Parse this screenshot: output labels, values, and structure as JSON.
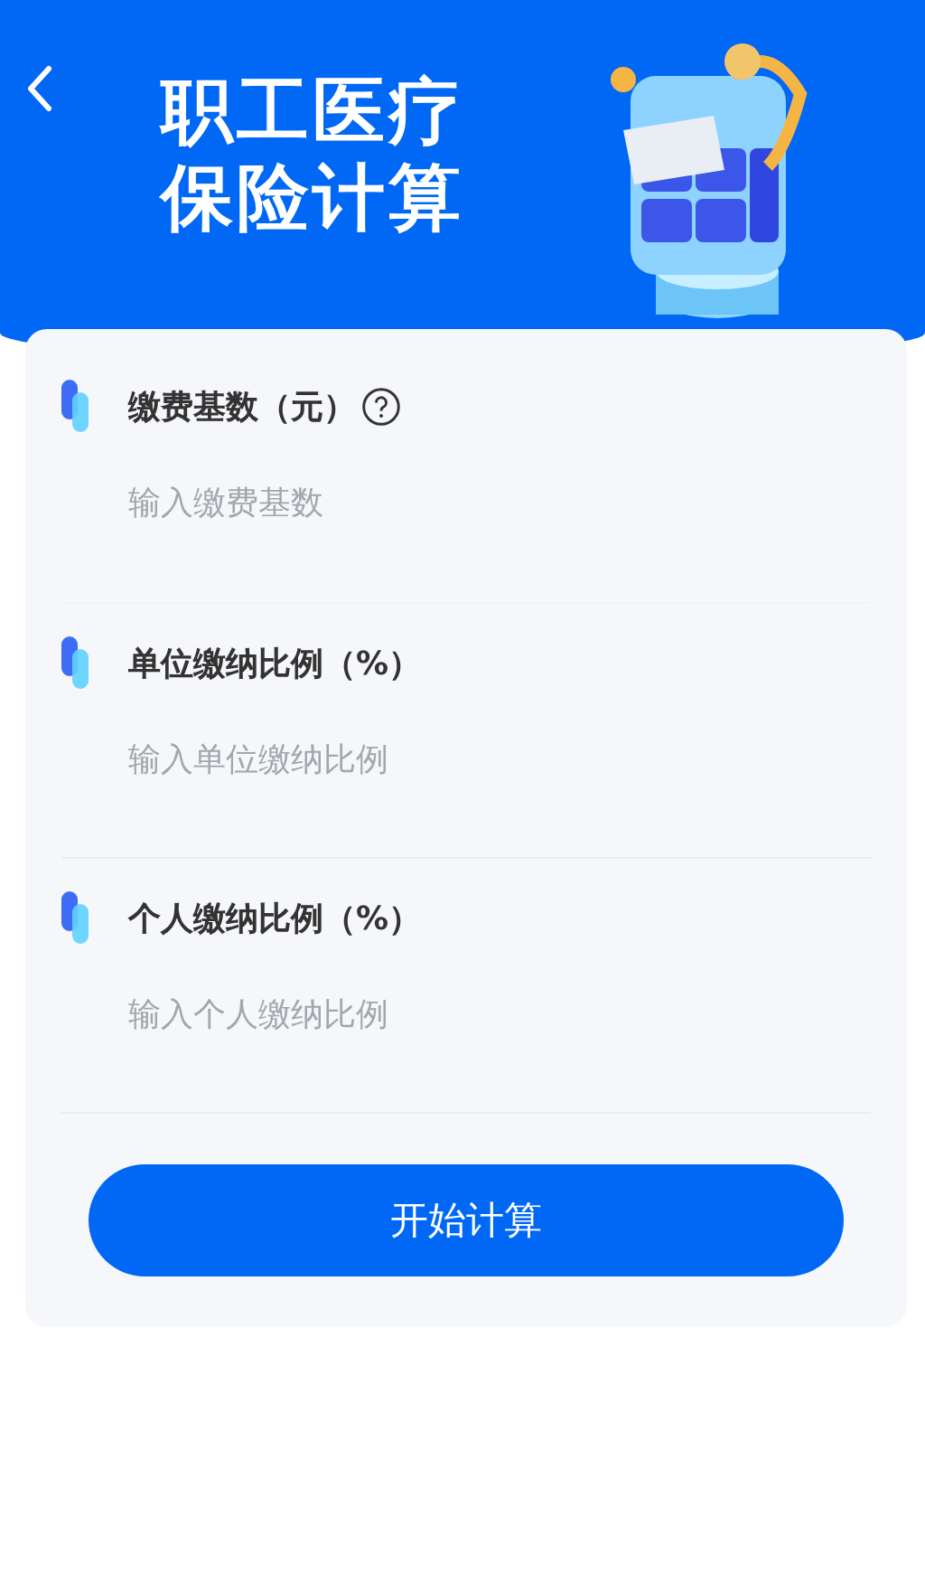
{
  "header": {
    "title_lines": [
      "职工医疗",
      "保险计算"
    ]
  },
  "fields": [
    {
      "label": "缴费基数（元）",
      "help": true,
      "placeholder": "输入缴费基数"
    },
    {
      "label": "单位缴纳比例（%）",
      "help": false,
      "placeholder": "输入单位缴纳比例"
    },
    {
      "label": "个人缴纳比例（%）",
      "help": false,
      "placeholder": "输入个人缴纳比例"
    }
  ],
  "button": "开始计算"
}
